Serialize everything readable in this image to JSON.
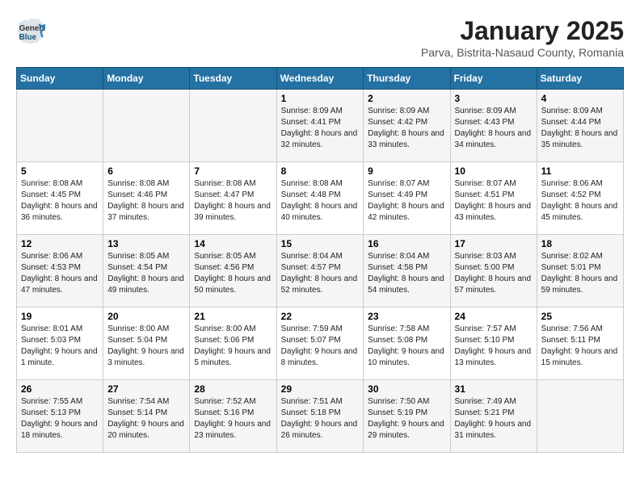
{
  "logo": {
    "general": "General",
    "blue": "Blue"
  },
  "header": {
    "title": "January 2025",
    "subtitle": "Parva, Bistrita-Nasaud County, Romania"
  },
  "days_of_week": [
    "Sunday",
    "Monday",
    "Tuesday",
    "Wednesday",
    "Thursday",
    "Friday",
    "Saturday"
  ],
  "weeks": [
    [
      {
        "day": "",
        "info": ""
      },
      {
        "day": "",
        "info": ""
      },
      {
        "day": "",
        "info": ""
      },
      {
        "day": "1",
        "info": "Sunrise: 8:09 AM\nSunset: 4:41 PM\nDaylight: 8 hours and 32 minutes."
      },
      {
        "day": "2",
        "info": "Sunrise: 8:09 AM\nSunset: 4:42 PM\nDaylight: 8 hours and 33 minutes."
      },
      {
        "day": "3",
        "info": "Sunrise: 8:09 AM\nSunset: 4:43 PM\nDaylight: 8 hours and 34 minutes."
      },
      {
        "day": "4",
        "info": "Sunrise: 8:09 AM\nSunset: 4:44 PM\nDaylight: 8 hours and 35 minutes."
      }
    ],
    [
      {
        "day": "5",
        "info": "Sunrise: 8:08 AM\nSunset: 4:45 PM\nDaylight: 8 hours and 36 minutes."
      },
      {
        "day": "6",
        "info": "Sunrise: 8:08 AM\nSunset: 4:46 PM\nDaylight: 8 hours and 37 minutes."
      },
      {
        "day": "7",
        "info": "Sunrise: 8:08 AM\nSunset: 4:47 PM\nDaylight: 8 hours and 39 minutes."
      },
      {
        "day": "8",
        "info": "Sunrise: 8:08 AM\nSunset: 4:48 PM\nDaylight: 8 hours and 40 minutes."
      },
      {
        "day": "9",
        "info": "Sunrise: 8:07 AM\nSunset: 4:49 PM\nDaylight: 8 hours and 42 minutes."
      },
      {
        "day": "10",
        "info": "Sunrise: 8:07 AM\nSunset: 4:51 PM\nDaylight: 8 hours and 43 minutes."
      },
      {
        "day": "11",
        "info": "Sunrise: 8:06 AM\nSunset: 4:52 PM\nDaylight: 8 hours and 45 minutes."
      }
    ],
    [
      {
        "day": "12",
        "info": "Sunrise: 8:06 AM\nSunset: 4:53 PM\nDaylight: 8 hours and 47 minutes."
      },
      {
        "day": "13",
        "info": "Sunrise: 8:05 AM\nSunset: 4:54 PM\nDaylight: 8 hours and 49 minutes."
      },
      {
        "day": "14",
        "info": "Sunrise: 8:05 AM\nSunset: 4:56 PM\nDaylight: 8 hours and 50 minutes."
      },
      {
        "day": "15",
        "info": "Sunrise: 8:04 AM\nSunset: 4:57 PM\nDaylight: 8 hours and 52 minutes."
      },
      {
        "day": "16",
        "info": "Sunrise: 8:04 AM\nSunset: 4:58 PM\nDaylight: 8 hours and 54 minutes."
      },
      {
        "day": "17",
        "info": "Sunrise: 8:03 AM\nSunset: 5:00 PM\nDaylight: 8 hours and 57 minutes."
      },
      {
        "day": "18",
        "info": "Sunrise: 8:02 AM\nSunset: 5:01 PM\nDaylight: 8 hours and 59 minutes."
      }
    ],
    [
      {
        "day": "19",
        "info": "Sunrise: 8:01 AM\nSunset: 5:03 PM\nDaylight: 9 hours and 1 minute."
      },
      {
        "day": "20",
        "info": "Sunrise: 8:00 AM\nSunset: 5:04 PM\nDaylight: 9 hours and 3 minutes."
      },
      {
        "day": "21",
        "info": "Sunrise: 8:00 AM\nSunset: 5:06 PM\nDaylight: 9 hours and 5 minutes."
      },
      {
        "day": "22",
        "info": "Sunrise: 7:59 AM\nSunset: 5:07 PM\nDaylight: 9 hours and 8 minutes."
      },
      {
        "day": "23",
        "info": "Sunrise: 7:58 AM\nSunset: 5:08 PM\nDaylight: 9 hours and 10 minutes."
      },
      {
        "day": "24",
        "info": "Sunrise: 7:57 AM\nSunset: 5:10 PM\nDaylight: 9 hours and 13 minutes."
      },
      {
        "day": "25",
        "info": "Sunrise: 7:56 AM\nSunset: 5:11 PM\nDaylight: 9 hours and 15 minutes."
      }
    ],
    [
      {
        "day": "26",
        "info": "Sunrise: 7:55 AM\nSunset: 5:13 PM\nDaylight: 9 hours and 18 minutes."
      },
      {
        "day": "27",
        "info": "Sunrise: 7:54 AM\nSunset: 5:14 PM\nDaylight: 9 hours and 20 minutes."
      },
      {
        "day": "28",
        "info": "Sunrise: 7:52 AM\nSunset: 5:16 PM\nDaylight: 9 hours and 23 minutes."
      },
      {
        "day": "29",
        "info": "Sunrise: 7:51 AM\nSunset: 5:18 PM\nDaylight: 9 hours and 26 minutes."
      },
      {
        "day": "30",
        "info": "Sunrise: 7:50 AM\nSunset: 5:19 PM\nDaylight: 9 hours and 29 minutes."
      },
      {
        "day": "31",
        "info": "Sunrise: 7:49 AM\nSunset: 5:21 PM\nDaylight: 9 hours and 31 minutes."
      },
      {
        "day": "",
        "info": ""
      }
    ]
  ]
}
